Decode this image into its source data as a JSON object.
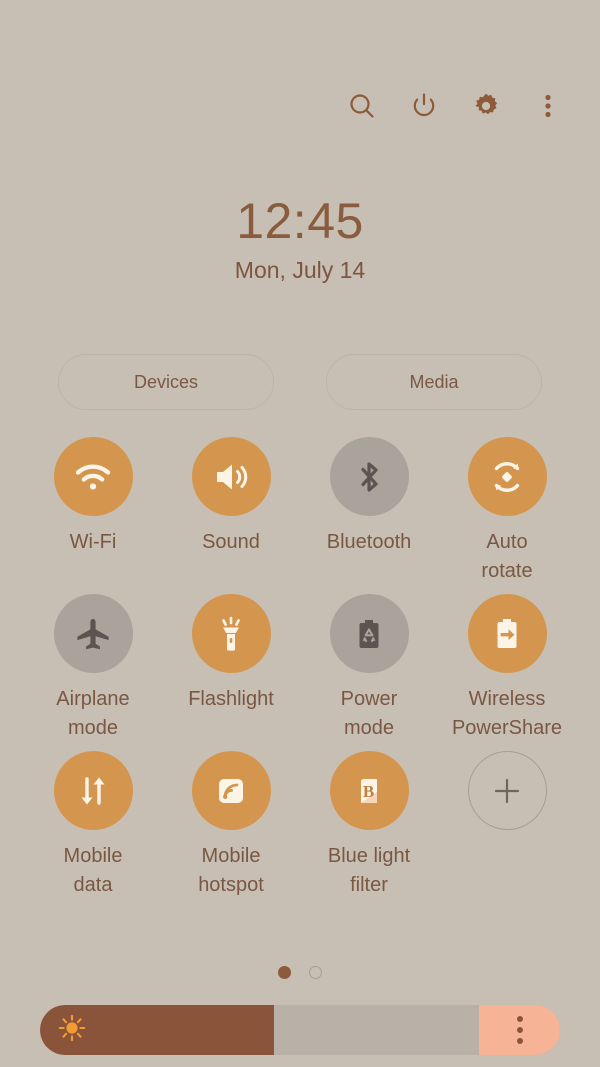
{
  "theme": {
    "background": "#c7bfb3",
    "accent_on": "#d4964f",
    "accent_off": "#a9a39b",
    "label_color": "#7a5743",
    "slider_fill": "#8a543a",
    "slider_track": "#b9b1a8",
    "slider_menu": "#f7b396"
  },
  "topbar": {
    "icons": [
      {
        "name": "search-icon",
        "label": "Search"
      },
      {
        "name": "power-icon",
        "label": "Power off"
      },
      {
        "name": "gear-icon",
        "label": "Settings"
      },
      {
        "name": "more-vertical-icon",
        "label": "More options"
      }
    ]
  },
  "clock": {
    "time": "12:45",
    "date": "Mon, July 14"
  },
  "pills": [
    {
      "label": "Devices"
    },
    {
      "label": "Media"
    }
  ],
  "toggles": [
    {
      "label": "Wi-Fi",
      "icon": "wifi-icon",
      "state": "on"
    },
    {
      "label": "Sound",
      "icon": "sound-icon",
      "state": "on"
    },
    {
      "label": "Bluetooth",
      "icon": "bluetooth-icon",
      "state": "off"
    },
    {
      "label": "Auto\nrotate",
      "icon": "auto-rotate-icon",
      "state": "on"
    },
    {
      "label": "Airplane\nmode",
      "icon": "airplane-icon",
      "state": "off"
    },
    {
      "label": "Flashlight",
      "icon": "flashlight-icon",
      "state": "on"
    },
    {
      "label": "Power\nmode",
      "icon": "power-mode-icon",
      "state": "off"
    },
    {
      "label": "Wireless\nPowerShare",
      "icon": "power-share-icon",
      "state": "on"
    },
    {
      "label": "Mobile\ndata",
      "icon": "mobile-data-icon",
      "state": "on"
    },
    {
      "label": "Mobile\nhotspot",
      "icon": "hotspot-icon",
      "state": "on"
    },
    {
      "label": "Blue light\nfilter",
      "icon": "blue-light-icon",
      "state": "on"
    },
    {
      "label": "",
      "icon": "plus-icon",
      "state": "add"
    }
  ],
  "pagination": {
    "pages": 2,
    "current": 1
  },
  "brightness": {
    "icon": "brightness-sun-icon",
    "value_percent": 45,
    "menu_icon": "more-vertical-icon"
  }
}
